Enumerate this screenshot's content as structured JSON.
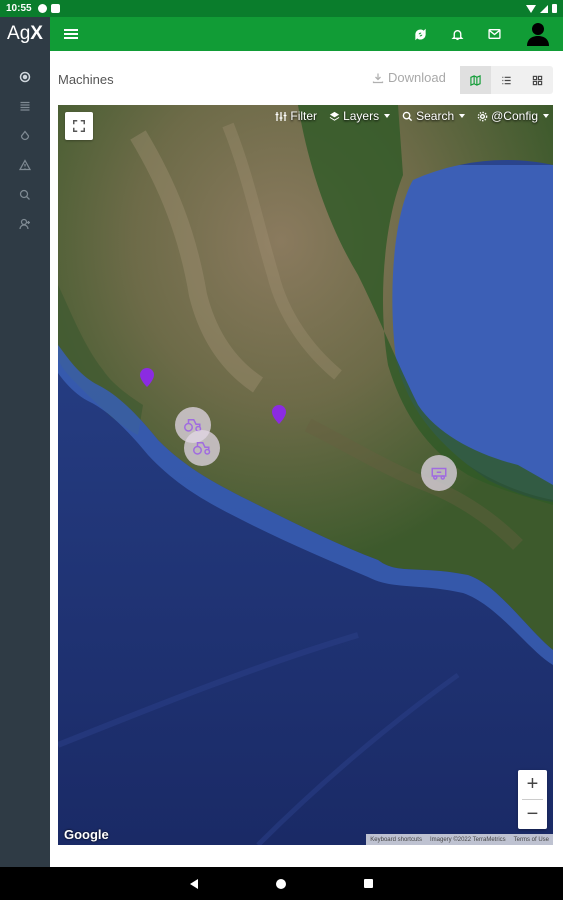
{
  "status_bar": {
    "time": "10:55"
  },
  "app": {
    "logo_prefix": "Ag",
    "logo_suffix": "X",
    "brand_color": "#119c36",
    "sidebar_color": "#2f3b45"
  },
  "header": {
    "actions": [
      {
        "name": "refresh-icon"
      },
      {
        "name": "bell-icon"
      },
      {
        "name": "mail-icon"
      },
      {
        "name": "user-avatar-icon"
      }
    ]
  },
  "sidebar": {
    "items": [
      {
        "icon": "dashboard-icon"
      },
      {
        "icon": "list-icon"
      },
      {
        "icon": "droplet-icon"
      },
      {
        "icon": "alert-icon"
      },
      {
        "icon": "search-icon"
      },
      {
        "icon": "user-icon"
      }
    ]
  },
  "page": {
    "title": "Machines",
    "download_label": "Download",
    "views": [
      {
        "name": "map-view",
        "icon": "map-icon",
        "active": true
      },
      {
        "name": "list-view",
        "icon": "list-icon",
        "active": false
      },
      {
        "name": "grid-view",
        "icon": "grid-icon",
        "active": false
      }
    ]
  },
  "map": {
    "toolbar": {
      "filter_label": "Filter",
      "layers_label": "Layers",
      "search_label": "Search",
      "config_label": "@Config"
    },
    "google_label": "Google",
    "attribution": {
      "shortcuts": "Keyboard shortcuts",
      "imagery": "Imagery ©2022 TerraMetrics",
      "terms": "Terms of Use"
    },
    "markers": [
      {
        "type": "pin",
        "color": "#8b2be2"
      },
      {
        "type": "pin",
        "color": "#8b2be2"
      },
      {
        "type": "cluster",
        "icon": "tractor-icon"
      },
      {
        "type": "cluster",
        "icon": "tractor-icon"
      },
      {
        "type": "cluster",
        "icon": "machine-icon"
      }
    ],
    "zoom_in_label": "+",
    "zoom_out_label": "−"
  }
}
